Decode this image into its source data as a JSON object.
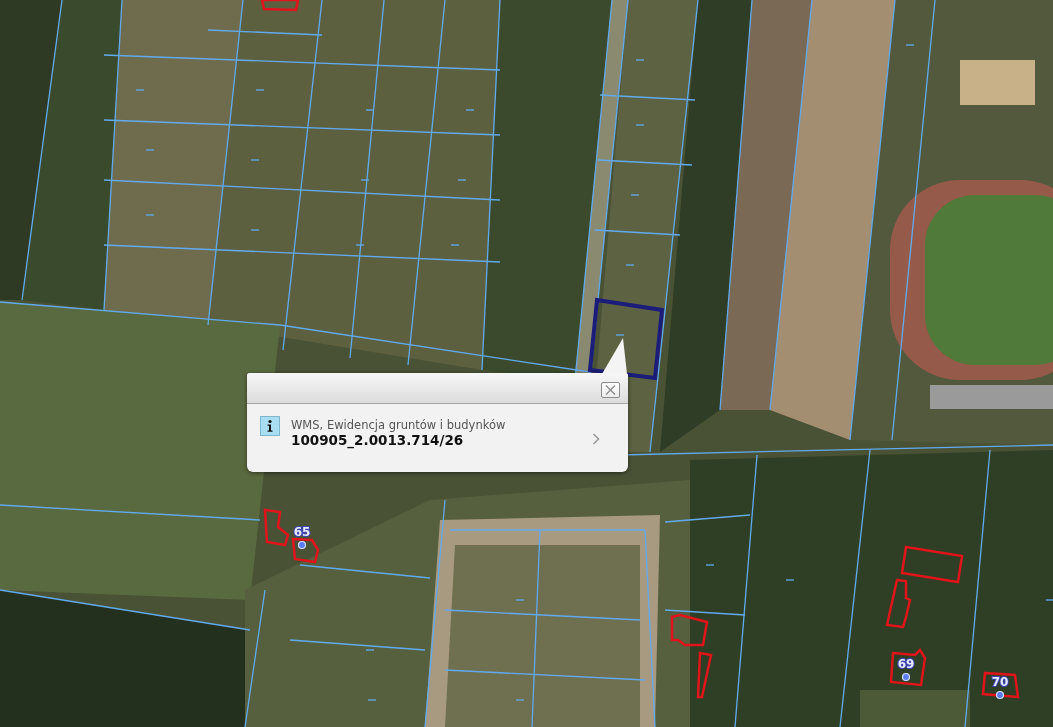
{
  "map": {
    "address_labels": [
      {
        "number": "65"
      },
      {
        "number": "69"
      },
      {
        "number": "70"
      }
    ]
  },
  "popup": {
    "layer_name": "WMS, Ewidencja gruntów i budynków",
    "parcel_id": "100905_2.0013.714/26"
  }
}
